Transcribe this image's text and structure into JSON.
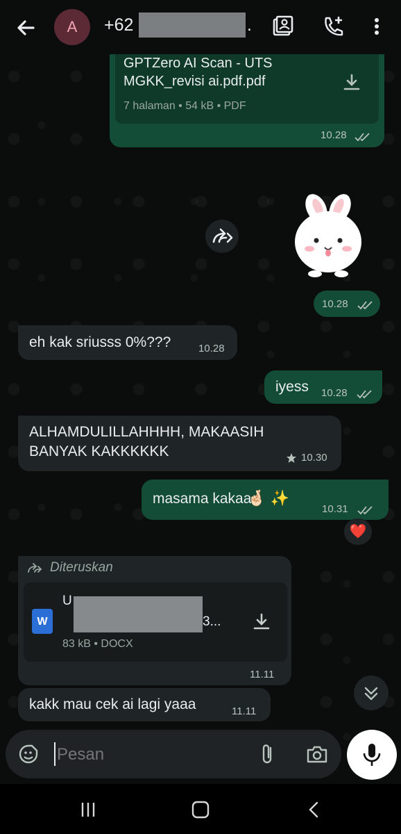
{
  "header": {
    "avatar_letter": "A",
    "contact_prefix": "+62",
    "contact_suffix": ".",
    "icons": [
      "back-arrow-icon",
      "contact-card-icon",
      "add-call-icon",
      "more-vert-icon"
    ]
  },
  "messages": [
    {
      "type": "document",
      "direction": "out",
      "title_line1": "GPTZero AI Scan - UTS",
      "title_line2": "MGKK_revisi ai.pdf.pdf",
      "meta": "7 halaman • 54 kB • PDF",
      "time": "10.28"
    },
    {
      "type": "sticker",
      "direction": "out",
      "time": "10.28",
      "forward_icon": "forward-icon"
    },
    {
      "type": "text",
      "direction": "in",
      "text": "eh kak sriusss 0%???",
      "time": "10.28"
    },
    {
      "type": "text",
      "direction": "out",
      "text": "iyess",
      "time": "10.28"
    },
    {
      "type": "text",
      "direction": "in",
      "starred": true,
      "line1": "ALHAMDULILLAHHHH, MAKAASIH",
      "line2": "BANYAK KAKKKKKK",
      "time": "10.30"
    },
    {
      "type": "text",
      "direction": "out",
      "text": "masama kakaa",
      "emoji": "🤞🏻 ✨",
      "time": "10.31",
      "reaction": "❤️"
    },
    {
      "type": "document",
      "direction": "in",
      "forwarded_label": "Diteruskan",
      "name_start": "U",
      "name_end": "3...",
      "meta": "83 kB • DOCX",
      "file_icon_letter": "W",
      "time": "11.11"
    },
    {
      "type": "text",
      "direction": "in",
      "text": "kakk mau cek ai lagi yaaa",
      "time": "11.11"
    }
  ],
  "composer": {
    "placeholder": "Pesan",
    "icons": [
      "sticker-icon",
      "attach-icon",
      "camera-icon",
      "mic-icon"
    ]
  },
  "navbar": {
    "icons": [
      "recent-apps-icon",
      "home-icon",
      "back-nav-icon"
    ]
  },
  "colors": {
    "outgoing": "#144d37",
    "incoming": "#1f2426",
    "background": "#0b0d0c",
    "reaction": "#e3334b"
  }
}
